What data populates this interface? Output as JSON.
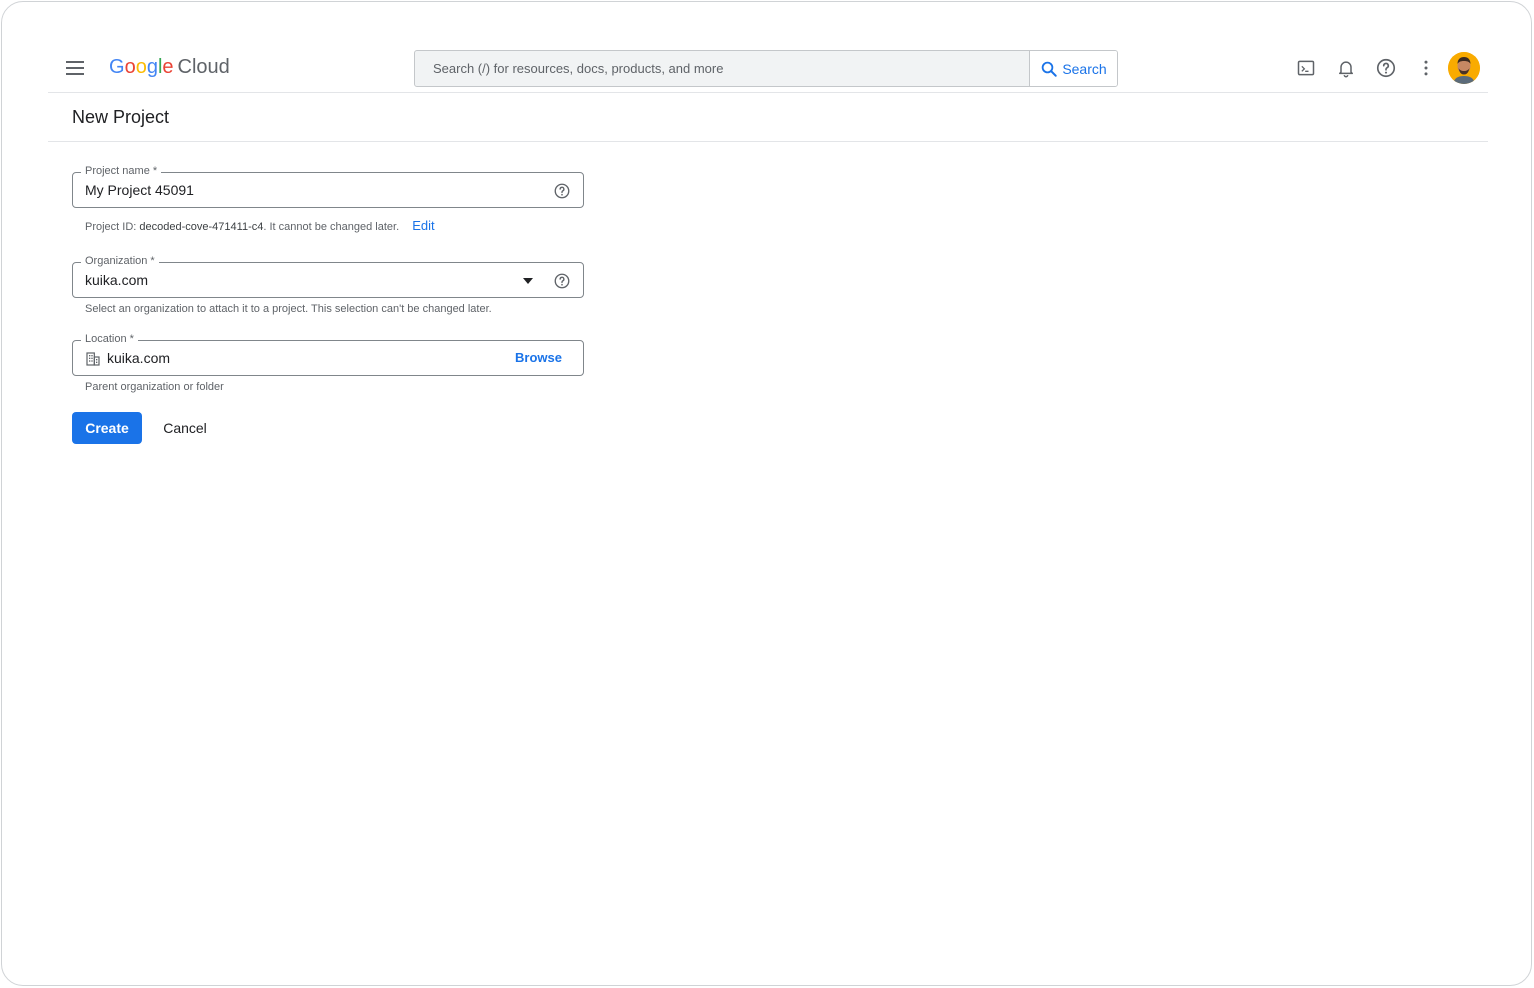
{
  "header": {
    "logo": {
      "google": [
        "G",
        "o",
        "o",
        "g",
        "l",
        "e"
      ],
      "google_colors": [
        "#4285F4",
        "#EA4335",
        "#FBBC05",
        "#4285F4",
        "#34A853",
        "#EA4335"
      ],
      "cloud": "Cloud"
    },
    "search": {
      "placeholder": "Search (/) for resources, docs, products, and more",
      "button_label": "Search"
    },
    "icons": [
      "cloud-shell-icon",
      "notifications-icon",
      "help-icon",
      "more-vert-icon",
      "avatar"
    ]
  },
  "page": {
    "title": "New Project"
  },
  "form": {
    "project_name": {
      "label": "Project name *",
      "value": "My Project 45091",
      "hint_prefix": "Project ID: ",
      "project_id": "decoded-cove-471411-c4",
      "hint_suffix": ". It cannot be changed later.",
      "edit_label": "Edit"
    },
    "organization": {
      "label": "Organization *",
      "value": "kuika.com",
      "hint": "Select an organization to attach it to a project. This selection can't be changed later."
    },
    "location": {
      "label": "Location *",
      "value": "kuika.com",
      "browse_label": "Browse",
      "hint": "Parent organization or folder"
    },
    "create_label": "Create",
    "cancel_label": "Cancel"
  },
  "colors": {
    "accent": "#1a73e8",
    "border": "#80868b",
    "avatar_bg": "#f9ab00"
  }
}
